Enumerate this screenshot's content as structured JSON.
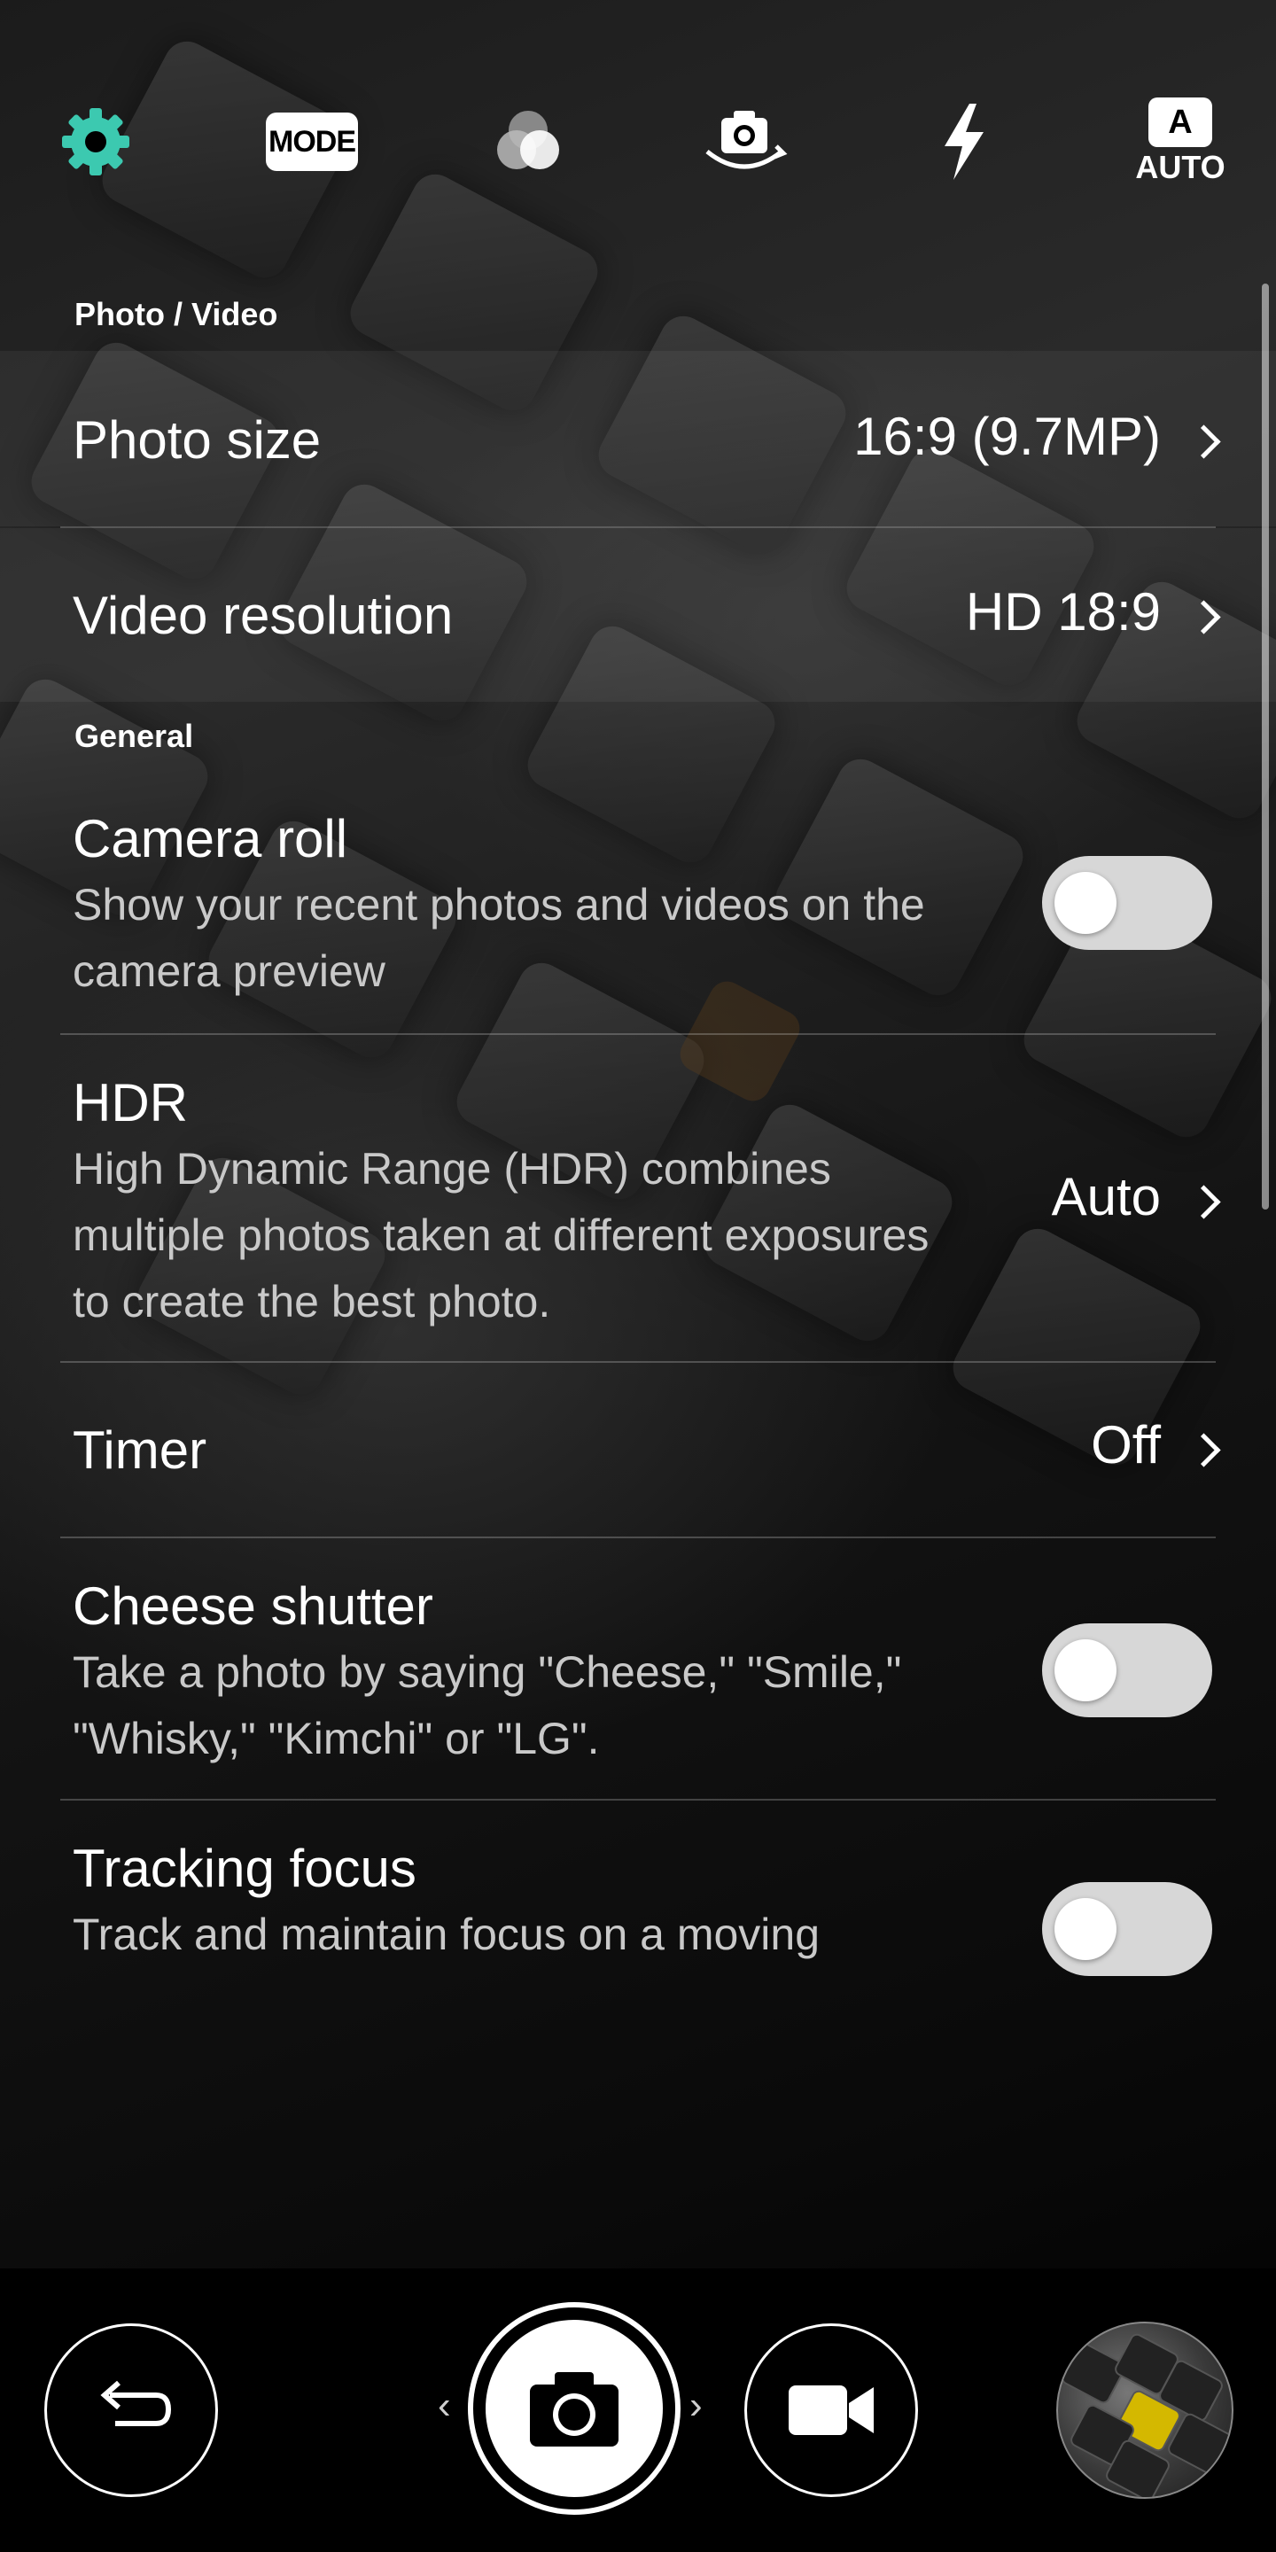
{
  "topbar": {
    "settings_icon": "gear-icon",
    "mode_label": "MODE",
    "filter_icon": "filter-circles-icon",
    "switch_camera_icon": "switch-camera-icon",
    "flash_icon": "flash-icon",
    "auto_badge": "A",
    "auto_label": "AUTO",
    "accent_color": "#3cc9b0"
  },
  "sections": {
    "photo_video": "Photo / Video",
    "general": "General"
  },
  "settings": {
    "photo_size": {
      "title": "Photo size",
      "value": "16:9 (9.7MP)"
    },
    "video_resolution": {
      "title": "Video resolution",
      "value": "HD 18:9"
    },
    "camera_roll": {
      "title": "Camera roll",
      "desc": "Show your recent photos and videos on the camera preview",
      "enabled": false
    },
    "hdr": {
      "title": "HDR",
      "desc": "High Dynamic Range (HDR) combines multiple photos taken at different exposures to create the best photo.",
      "value": "Auto"
    },
    "timer": {
      "title": "Timer",
      "value": "Off"
    },
    "cheese_shutter": {
      "title": "Cheese shutter",
      "desc": "Take a photo by saying \"Cheese,\" \"Smile,\" \"Whisky,\" \"Kimchi\" or \"LG\".",
      "enabled": false
    },
    "tracking_focus": {
      "title": "Tracking focus",
      "desc": "Track and maintain focus on a moving",
      "enabled": false
    }
  },
  "bottom": {
    "back_icon": "back-arrow-icon",
    "shutter_icon": "camera-icon",
    "video_icon": "video-camera-icon",
    "gallery_icon": "gallery-thumbnail",
    "prev_mode": "‹",
    "next_mode": "›"
  }
}
